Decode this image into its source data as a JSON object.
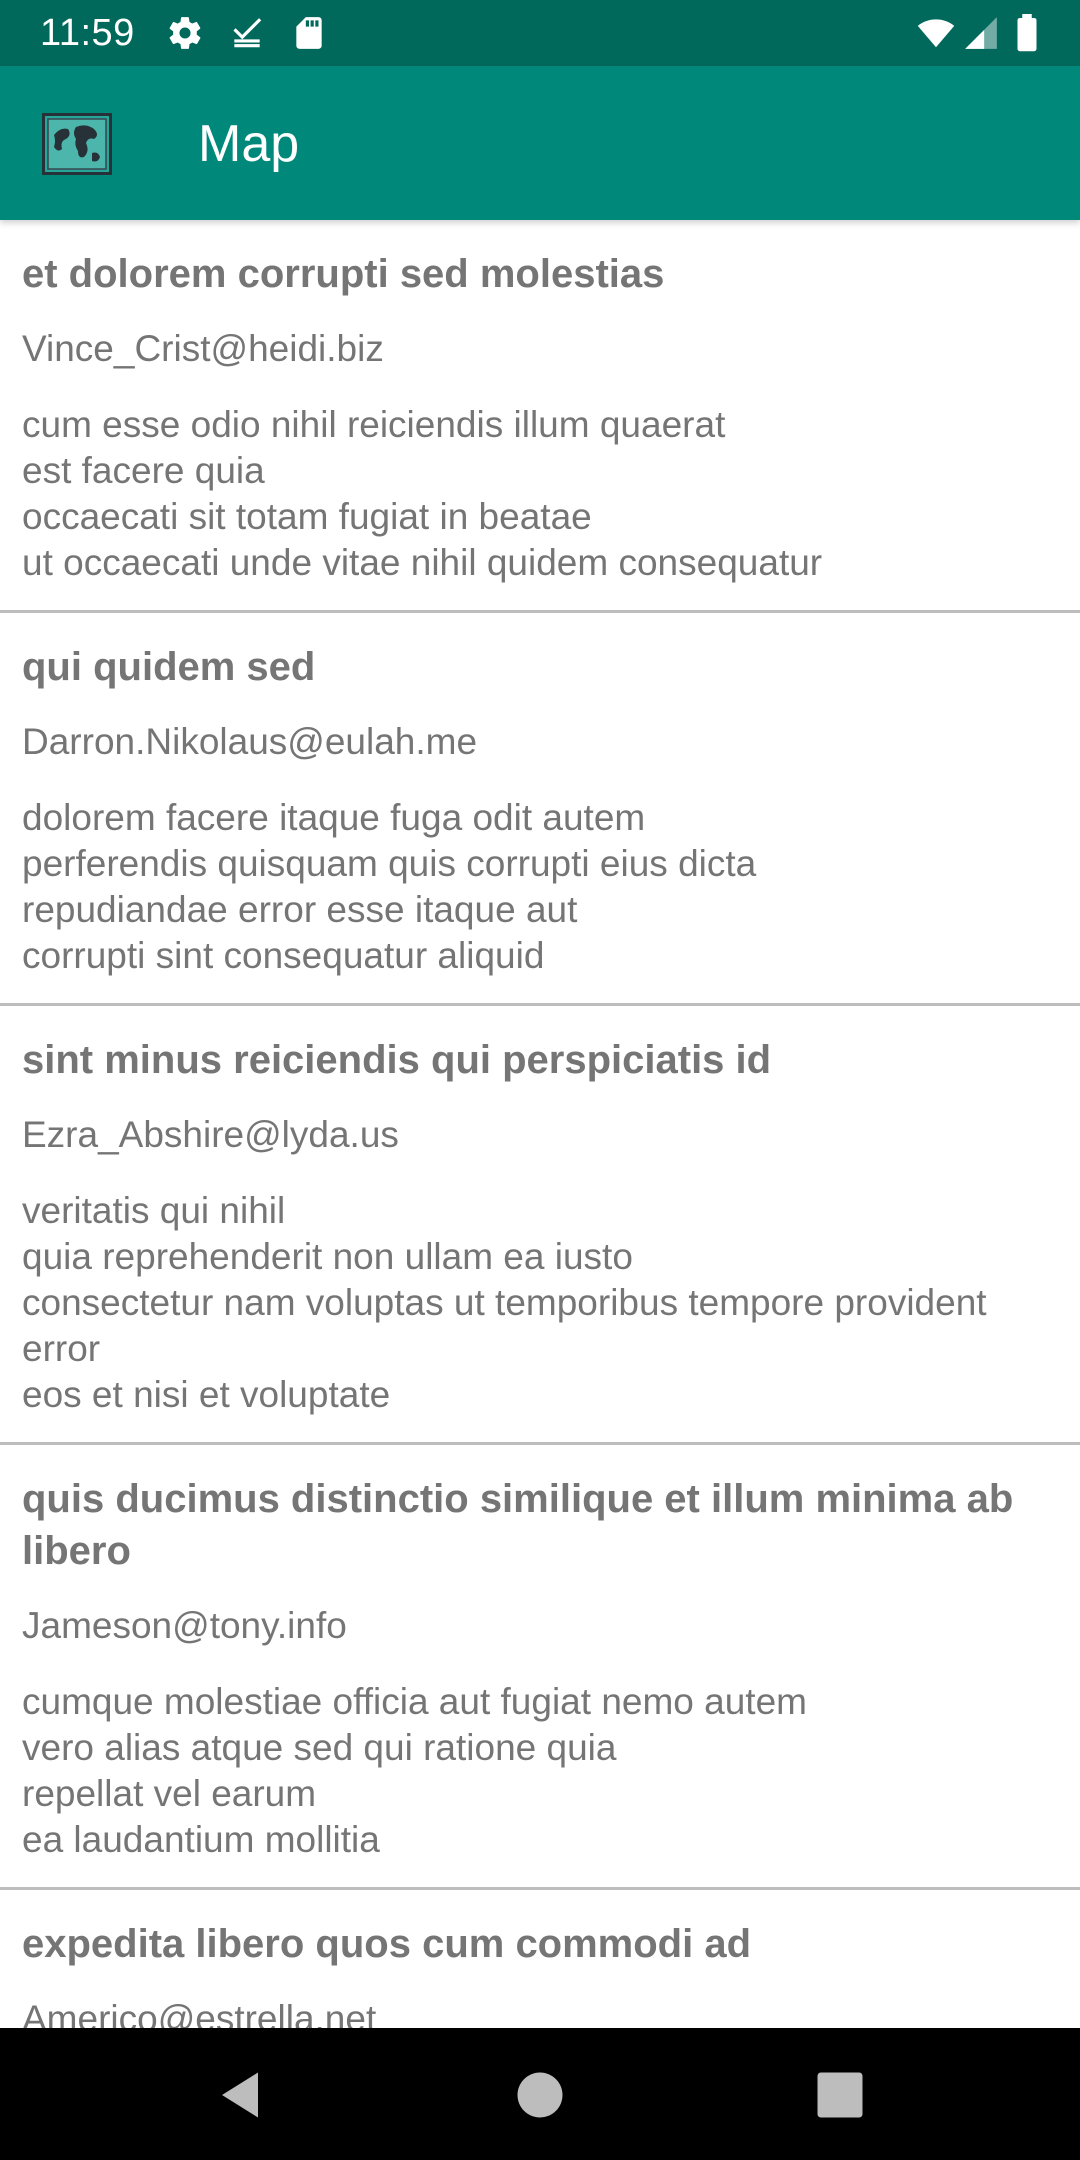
{
  "status_bar": {
    "time": "11:59",
    "left_icons": [
      "settings-icon",
      "download-done-icon",
      "sd-card-icon"
    ],
    "right_icons": [
      "wifi-icon",
      "cell-signal-icon",
      "battery-icon"
    ],
    "background": "#00695c"
  },
  "app_bar": {
    "title": "Map",
    "logo_icon": "world-map-icon",
    "background": "#00897b"
  },
  "posts": [
    {
      "title": "et dolorem corrupti sed molestias",
      "email": "Vince_Crist@heidi.biz",
      "body": "cum esse odio nihil reiciendis illum quaerat\nest facere quia\noccaecati sit totam fugiat in beatae\nut occaecati unde vitae nihil quidem consequatur"
    },
    {
      "title": "qui quidem sed",
      "email": "Darron.Nikolaus@eulah.me",
      "body": "dolorem facere itaque fuga odit autem\nperferendis quisquam quis corrupti eius dicta\nrepudiandae error esse itaque aut\ncorrupti sint consequatur aliquid"
    },
    {
      "title": "sint minus reiciendis qui perspiciatis id",
      "email": "Ezra_Abshire@lyda.us",
      "body": "veritatis qui nihil\nquia reprehenderit non ullam ea iusto\nconsectetur nam voluptas ut temporibus tempore provident error\neos et nisi et voluptate"
    },
    {
      "title": "quis ducimus distinctio similique et illum minima ab libero",
      "email": "Jameson@tony.info",
      "body": "cumque molestiae officia aut fugiat nemo autem\nvero alias atque sed qui ratione quia\nrepellat vel earum\nea laudantium mollitia"
    },
    {
      "title": "expedita libero quos cum commodi ad",
      "email": "Americo@estrella.net",
      "body": ""
    }
  ],
  "nav_bar": {
    "buttons": [
      "back-icon",
      "home-icon",
      "recents-icon"
    ]
  }
}
